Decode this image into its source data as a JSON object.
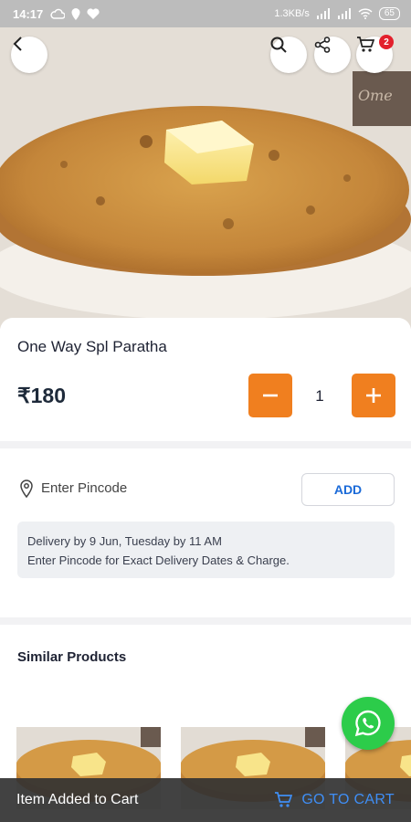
{
  "status_bar": {
    "time": "14:17",
    "network_speed": "1.3KB/s",
    "battery": "65"
  },
  "top_bar": {
    "cart_count": "2"
  },
  "product": {
    "name": "One Way Spl Paratha",
    "price": "₹180",
    "quantity": "1"
  },
  "pincode": {
    "placeholder": "Enter Pincode",
    "add_label": "ADD",
    "delivery_line1": "Delivery by 9 Jun, Tuesday by 11 AM",
    "delivery_line2": "Enter Pincode for Exact Delivery Dates & Charge."
  },
  "similar": {
    "title": "Similar Products"
  },
  "snackbar": {
    "message": "Item Added to Cart",
    "action_label": "GO TO CART"
  },
  "colors": {
    "accent_orange": "#f07f1f",
    "link_blue": "#1a6ad8",
    "whatsapp_green": "#2ccc4a",
    "badge_red": "#e3202c"
  }
}
